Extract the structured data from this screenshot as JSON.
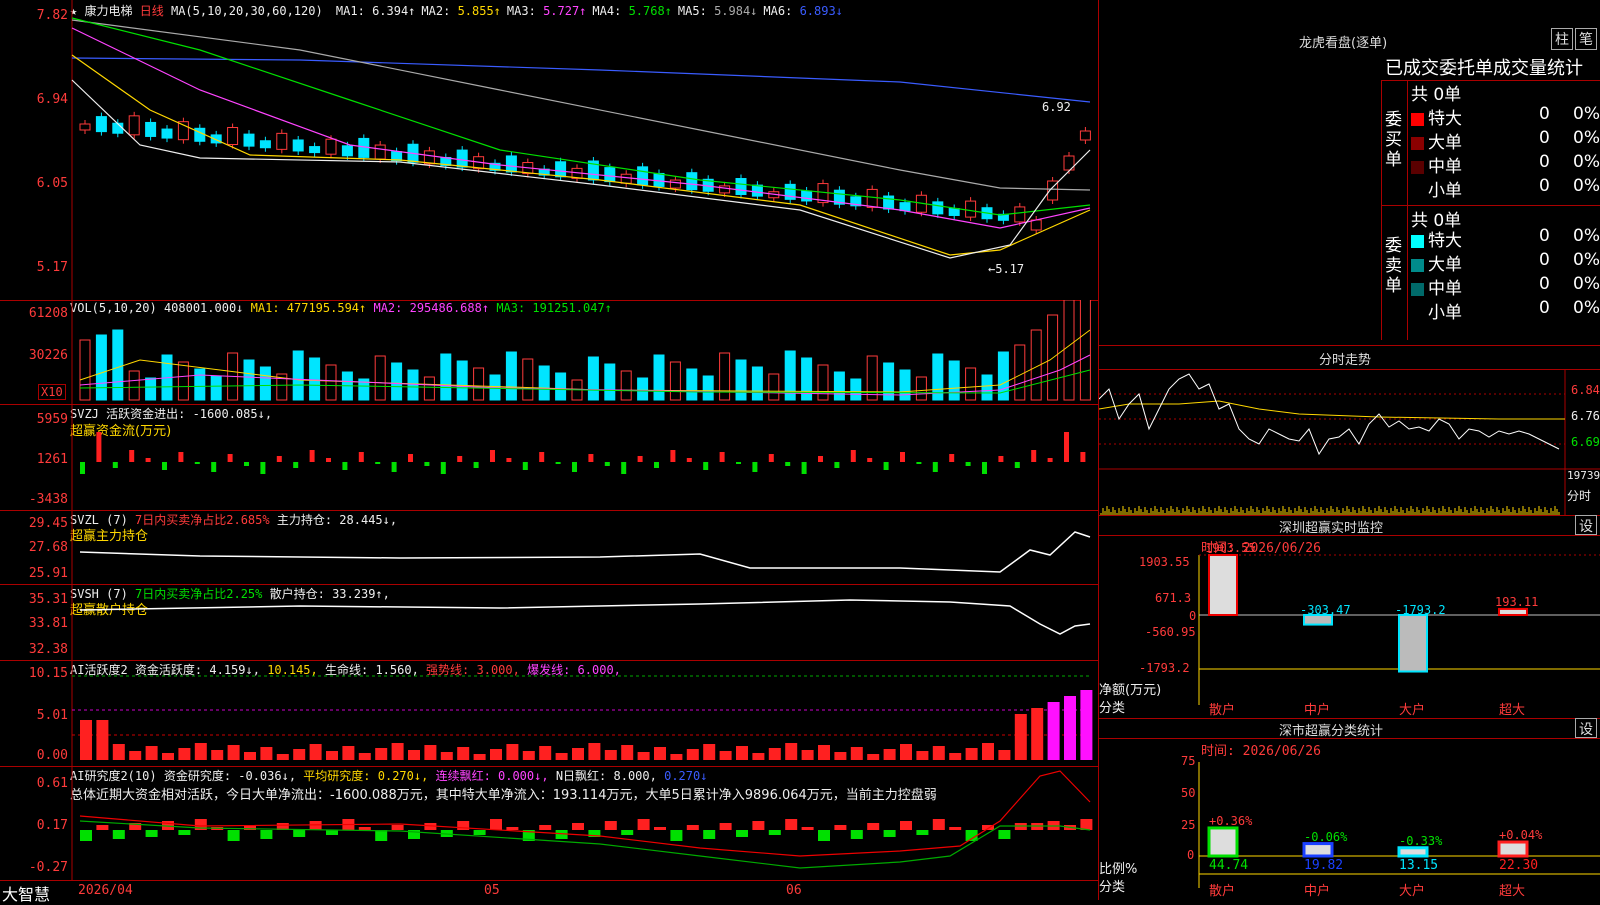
{
  "price": {
    "title": "康力电梯",
    "period": "日线",
    "ma_label": "MA(5,10,20,30,60,120)",
    "ma": [
      {
        "name": "MA1:",
        "value": "6.394↑",
        "color": "#eeeeee"
      },
      {
        "name": "MA2:",
        "value": "5.855↑",
        "color": "#ffd700"
      },
      {
        "name": "MA3:",
        "value": "5.727↑",
        "color": "#ff44ff"
      },
      {
        "name": "MA4:",
        "value": "5.768↑",
        "color": "#00e000"
      },
      {
        "name": "MA5:",
        "value": "5.984↓",
        "color": "#aaaaaa"
      },
      {
        "name": "MA6:",
        "value": "6.893↓",
        "color": "#3a5cff"
      }
    ],
    "axis": [
      "7.82",
      "6.94",
      "6.05",
      "5.17"
    ],
    "high_label": "6.92",
    "low_label": "←5.17"
  },
  "vol": {
    "label": "VOL(5,10,20)",
    "value": "408001.000↓",
    "ma1": "MA1: 477195.594↑",
    "ma2": "MA2: 295486.688↑",
    "ma3": "MA3: 191251.047↑",
    "axis": [
      "61208",
      "30226"
    ],
    "unit": "X10"
  },
  "svzj": {
    "label": "SVZJ  活跃资金进出: -1600.085↓,",
    "sub": "超赢资金流(万元)",
    "axis": [
      "5959",
      "1261",
      "-3438"
    ]
  },
  "svzl": {
    "label": "SVZL (7)",
    "desc": "7日内买卖净占比2.685%",
    "extra": "主力持仓: 28.445↓,",
    "sub": "超赢主力持仓",
    "axis": [
      "29.45",
      "27.68",
      "25.91"
    ]
  },
  "svsh": {
    "label": "SVSH (7)",
    "desc": "7日内买卖净占比2.25%",
    "extra": "散户持仓: 33.239↑,",
    "sub": "超赢散户持仓",
    "axis": [
      "35.31",
      "33.81",
      "32.38"
    ]
  },
  "ai1": {
    "label": "AI活跃度2",
    "a": "资金活跃度: 4.159↓,",
    "b": "10.145,",
    "c": "生命线: 1.560,",
    "d": "强势线: 3.000,",
    "e": "爆发线: 6.000,",
    "axis": [
      "10.15",
      "5.01",
      "0.00"
    ]
  },
  "ai2": {
    "label": "AI研究度2(10)",
    "a": "资金研究度: -0.036↓,",
    "b": "平均研究度: 0.270↓,",
    "c": "连续飘红: 0.000↓,",
    "d": "N日飘红: 8.000,",
    "e": "0.270↓",
    "summary": "总体近期大资金相对活跃，今日大单净流出：-1600.088万元，其中特大单净流入：193.114万元，大单5日累计净入9896.064万元，当前主力控盘弱",
    "axis": [
      "0.61",
      "0.17",
      "-0.27"
    ]
  },
  "xaxis": [
    "2026/04",
    "05",
    "06"
  ],
  "brand": "大智慧",
  "dragon": {
    "title": "龙虎看盘(逐单)",
    "btn1": "柱",
    "btn2": "笔",
    "header": "已成交委托单成交量统计",
    "buy_label": "委买单",
    "sell_label": "委卖单",
    "buy_total": "共 0单",
    "sell_total": "共 0单",
    "rows_buy": [
      {
        "name": "特大",
        "n": "0",
        "p": "0%",
        "color": "#ff0000"
      },
      {
        "name": "大单",
        "n": "0",
        "p": "0%",
        "color": "#8b0000"
      },
      {
        "name": "中单",
        "n": "0",
        "p": "0%",
        "color": "#5a0000"
      },
      {
        "name": "小单",
        "n": "0",
        "p": "0%",
        "color": ""
      }
    ],
    "rows_sell": [
      {
        "name": "特大",
        "n": "0",
        "p": "0%",
        "color": "#00ffff"
      },
      {
        "name": "大单",
        "n": "0",
        "p": "0%",
        "color": "#008b8b"
      },
      {
        "name": "中单",
        "n": "0",
        "p": "0%",
        "color": "#006a6a"
      },
      {
        "name": "小单",
        "n": "0",
        "p": "0%",
        "color": ""
      }
    ]
  },
  "intraday": {
    "title": "分时走势",
    "axis": [
      "6.84",
      "6.76",
      "6.69"
    ],
    "vol_top": "19739",
    "vol_bottom": "分时"
  },
  "monitor": {
    "title": "深圳超赢实时监控",
    "set": "设",
    "time": "时间: 2026/06/26",
    "axis": [
      "1903.55",
      "671.3",
      "0",
      "-560.95",
      "-1793.2"
    ],
    "ylabel": "净额(万元)",
    "xlabel": "分类",
    "cats": [
      "散户",
      "中户",
      "大户",
      "超大"
    ],
    "values": [
      1903.55,
      -303.47,
      -1793.2,
      193.11
    ],
    "labels": [
      "1903.55",
      "-303.47",
      "-1793.2",
      "193.11"
    ]
  },
  "classify": {
    "title": "深市超赢分类统计",
    "set": "设",
    "time": "时间: 2026/06/26",
    "axis": [
      "75",
      "50",
      "25",
      "0"
    ],
    "ylabel": "比例%",
    "xlabel": "分类",
    "cats": [
      "散户",
      "中户",
      "大户",
      "超大"
    ],
    "values": [
      44.74,
      19.82,
      13.15,
      22.3
    ],
    "value_labels": [
      "44.74",
      "19.82",
      "13.15",
      "22.30"
    ],
    "changes": [
      "+0.36%",
      "-0.06%",
      "-0.33%",
      "+0.04%"
    ]
  }
}
